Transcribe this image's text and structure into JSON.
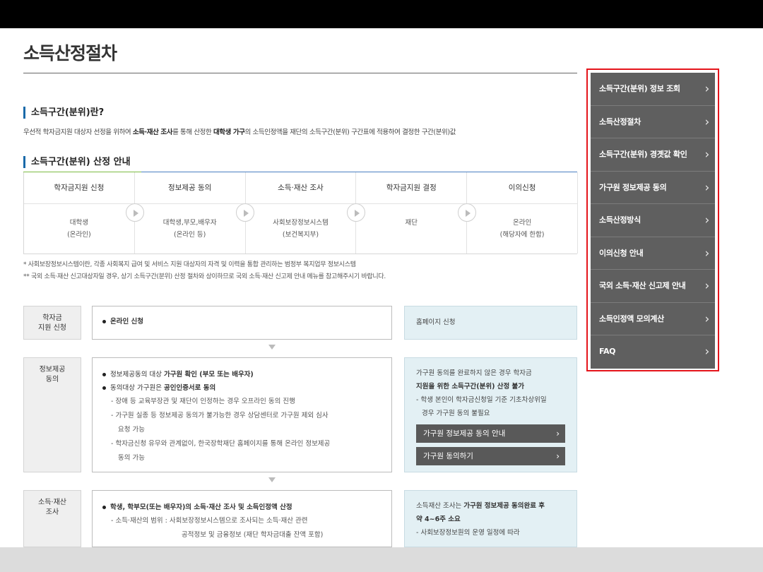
{
  "page": {
    "title": "소득산정절차"
  },
  "section_def": {
    "heading": "소득구간(분위)란?",
    "text_parts": [
      "우선적 학자금지원 대상자 선정을 위하여 ",
      "소득·재산 조사",
      "를 통해 산정한 ",
      "대학생 가구",
      "의 소득인정액을 재단의 소득구간(분위) 구간표에 적용하여 결정한 구간(분위)값"
    ]
  },
  "section_steps": {
    "heading": "소득구간(분위) 산정 안내",
    "steps": [
      {
        "title": "학자금지원 신청",
        "line1": "대학생",
        "line2": "(온라인)"
      },
      {
        "title": "정보제공 동의",
        "line1": "대학생,부모,배우자",
        "line2": "(온라인 등)"
      },
      {
        "title": "소득·재산 조사",
        "line1": "사회보장정보시스템",
        "line2": "(보건복지부)"
      },
      {
        "title": "학자금지원 결정",
        "line1": "재단",
        "line2": ""
      },
      {
        "title": "이의신청",
        "line1": "온라인",
        "line2": "(해당자에 한함)"
      }
    ],
    "notes": [
      "* 사회보장정보시스템이란, 각종 사회복지 급여 및 서비스 지원 대상자의 자격 및 이력을 통합 관리하는 범정부 복지업무 정보시스템",
      "** 국외 소득·재산 신고대상자일 경우, 상기 소득구간(분위) 산정 절차와 상이하므로 국외 소득·재산 신고제 안내 메뉴를 참고해주시기 바랍니다."
    ]
  },
  "flow": {
    "row1": {
      "label_l1": "학자금",
      "label_l2": "지원 신청",
      "main": "온라인 신청",
      "side": "홈페이지 신청"
    },
    "row2": {
      "label_l1": "정보제공",
      "label_l2": "동의",
      "b1_pre": "정보제공동의 대상 ",
      "b1_bold": "가구원 확인 (부모 또는 배우자)",
      "b2_pre": "동의대상 가구원은 ",
      "b2_bold": "공인인증서로 동의",
      "s1": "- 장애 등 교육부장관 및 재단이 인정하는 경우 오프라인 동의 진행",
      "s2a": "- 가구원 실종 등 정보제공 동의가 불가능한 경우 상담센터로 가구원 제외 심사",
      "s2b": "요청 가능",
      "s3a": "- 학자금신청 유무와 관계없이, 한국장학재단 홈페이지를 통해 온라인 정보제공",
      "s3b": "동의 가능",
      "side_l1": "가구원 동의를 완료하지 않은 경우 학자금",
      "side_l2": "지원을 위한 소득구간(분위) 산정 불가",
      "side_l3": "- 학생 본인이 학자금신청일 기준 기초차상위일",
      "side_l4": "경우 가구원 동의 불필요",
      "btn1": "가구원 정보제공 동의 안내",
      "btn2": "가구원 동의하기"
    },
    "row3": {
      "label_l1": "소득·재산",
      "label_l2": "조사",
      "b1": "학생, 학부모(또는 배우자)의 소득·재산 조사 및 소득인정액 산정",
      "s1": "- 소득·재산의 범위 : 사회보장정보시스템으로 조사되는 소득·재산 관련",
      "s1b": "공적정보 및 금융정보 (재단 학자금대출 잔액 포함)",
      "side_l1a": "소득재산 조사는 ",
      "side_l1b": "가구원 정보제공 동의완료 후",
      "side_l2": "약 4~6주 소요",
      "side_l3": "- 사회보장정보원의 운영 일정에 따라"
    }
  },
  "side_menu": {
    "items": [
      "소득구간(분위) 정보 조회",
      "소득산정절차",
      "소득구간(분위) 경곗값 확인",
      "가구원 정보제공 동의",
      "소득산정방식",
      "이의신청 안내",
      "국외 소득·재산 신고제 안내",
      "소득인정액 모의계산",
      "FAQ"
    ]
  },
  "icons": {
    "chevron": "›",
    "colors": {
      "accent_blue": "#1a6aa9",
      "green": "#7dbb42",
      "side_bg": "#5f5f5f",
      "highlight": "#e5141b"
    }
  }
}
